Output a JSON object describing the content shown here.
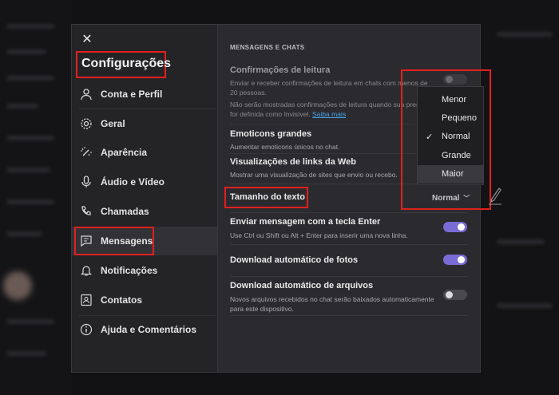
{
  "sidebar": {
    "title": "Configurações",
    "items": [
      {
        "label": "Conta e Perfil",
        "icon": "person-icon"
      },
      {
        "label": "Geral",
        "icon": "gear-icon"
      },
      {
        "label": "Aparência",
        "icon": "magic-wand-icon"
      },
      {
        "label": "Áudio e Vídeo",
        "icon": "microphone-icon"
      },
      {
        "label": "Chamadas",
        "icon": "phone-icon"
      },
      {
        "label": "Mensagens",
        "icon": "message-icon"
      },
      {
        "label": "Notificações",
        "icon": "bell-icon"
      },
      {
        "label": "Contatos",
        "icon": "contacts-icon"
      },
      {
        "label": "Ajuda e Comentários",
        "icon": "info-icon"
      }
    ],
    "active": "Mensagens"
  },
  "content": {
    "section": "MENSAGENS E CHATS",
    "read_receipts": {
      "title": "Confirmações de leitura",
      "desc": "Enviar e receber confirmações de leitura em chats com menos de 20 pessoas.",
      "note": "Não serão mostradas confirmações de leitura quando sua presença for definida como Invisível.",
      "link": "Saiba mais"
    },
    "emoticons": {
      "title": "Emoticons grandes",
      "desc": "Aumentar emoticons únicos no chat."
    },
    "link_preview": {
      "title": "Visualizações de links da Web",
      "desc": "Mostrar uma visualização de sites que envio ou recebo."
    },
    "text_size": {
      "title": "Tamanho do texto",
      "value": "Normal"
    },
    "enter_send": {
      "title": "Enviar mensagem com a tecla Enter",
      "desc": "Use Ctrl ou Shift ou Alt + Enter para inserir uma nova linha."
    },
    "auto_photos": {
      "title": "Download automático de fotos"
    },
    "auto_files": {
      "title": "Download automático de arquivos",
      "desc": "Novos arquivos recebidos no chat serão baixados automaticamente para este dispositivo."
    }
  },
  "dropdown": {
    "options": [
      "Menor",
      "Pequeno",
      "Normal",
      "Grande",
      "Maior"
    ],
    "selected": "Normal",
    "hovered": "Maior"
  },
  "colors": {
    "accent": "#7a6cd6",
    "highlight": "#e0201e",
    "link": "#4aa4e8"
  }
}
